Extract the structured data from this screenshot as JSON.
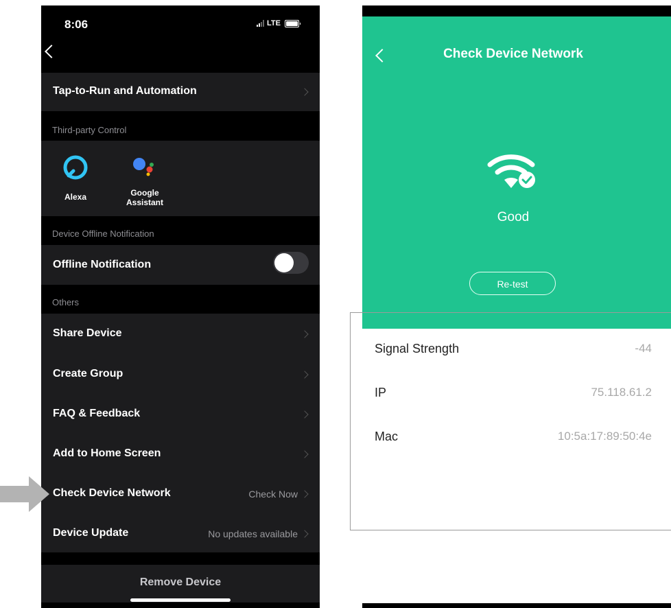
{
  "left_screen": {
    "status_bar": {
      "time": "8:06",
      "network": "LTE"
    },
    "rows": {
      "tap_to_run": "Tap-to-Run and Automation",
      "offline_notification": "Offline Notification",
      "share_device": "Share Device",
      "create_group": "Create Group",
      "faq_feedback": "FAQ & Feedback",
      "add_to_home": "Add to Home Screen",
      "check_network": {
        "label": "Check Device Network",
        "value": "Check Now"
      },
      "device_update": {
        "label": "Device Update",
        "value": "No updates available"
      },
      "remove_device": "Remove Device"
    },
    "sections": {
      "third_party": "Third-party Control",
      "offline": "Device Offline Notification",
      "others": "Others"
    },
    "third_party_items": {
      "alexa": "Alexa",
      "google_line1": "Google",
      "google_line2": "Assistant"
    },
    "offline_toggle_on": false
  },
  "right_screen": {
    "title": "Check Device Network",
    "status": "Good",
    "retest_label": "Re-test",
    "accent_color": "#1fc490",
    "info": [
      {
        "key": "Signal Strength",
        "value": "-44"
      },
      {
        "key": "IP",
        "value": "75.118.61.2"
      },
      {
        "key": "Mac",
        "value": "10:5a:17:89:50:4e"
      }
    ]
  }
}
